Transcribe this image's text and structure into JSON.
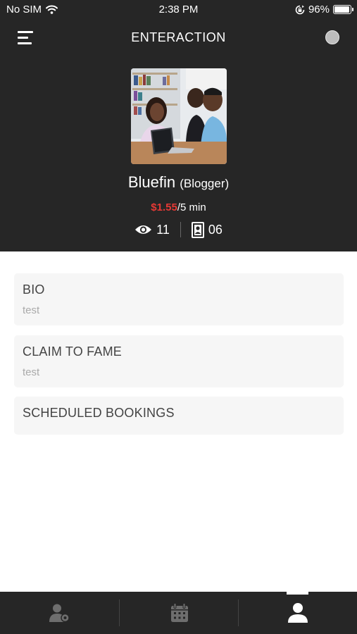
{
  "status_bar": {
    "carrier": "No SIM",
    "time": "2:38 PM",
    "battery_percent": "96%",
    "battery_level": 0.96,
    "icons": [
      "wifi-icon",
      "rotation-lock-icon",
      "battery-icon"
    ]
  },
  "nav": {
    "title": "ENTERACTION",
    "icons": [
      "menu-icon",
      "status-dot-icon"
    ]
  },
  "profile": {
    "name": "Bluefin",
    "role": "(Blogger)",
    "price": "$1.55",
    "rate_unit": "/5 min",
    "views": "11",
    "bookings": "06",
    "icons": [
      "eye-icon",
      "contact-card-icon"
    ]
  },
  "sections": {
    "bio": {
      "title": "BIO",
      "text": "test"
    },
    "claim": {
      "title": "CLAIM TO FAME",
      "text": "test"
    },
    "scheduled": {
      "title": "SCHEDULED BOOKINGS"
    }
  },
  "tabs": [
    {
      "icon": "user-settings-icon",
      "active": false
    },
    {
      "icon": "calendar-icon",
      "active": false
    },
    {
      "icon": "profile-icon",
      "active": true
    }
  ],
  "colors": {
    "header_bg": "#262626",
    "price": "#e53935",
    "card_bg": "#f6f6f6",
    "inactive_icon": "#6e6e6e",
    "active_icon": "#ffffff"
  }
}
